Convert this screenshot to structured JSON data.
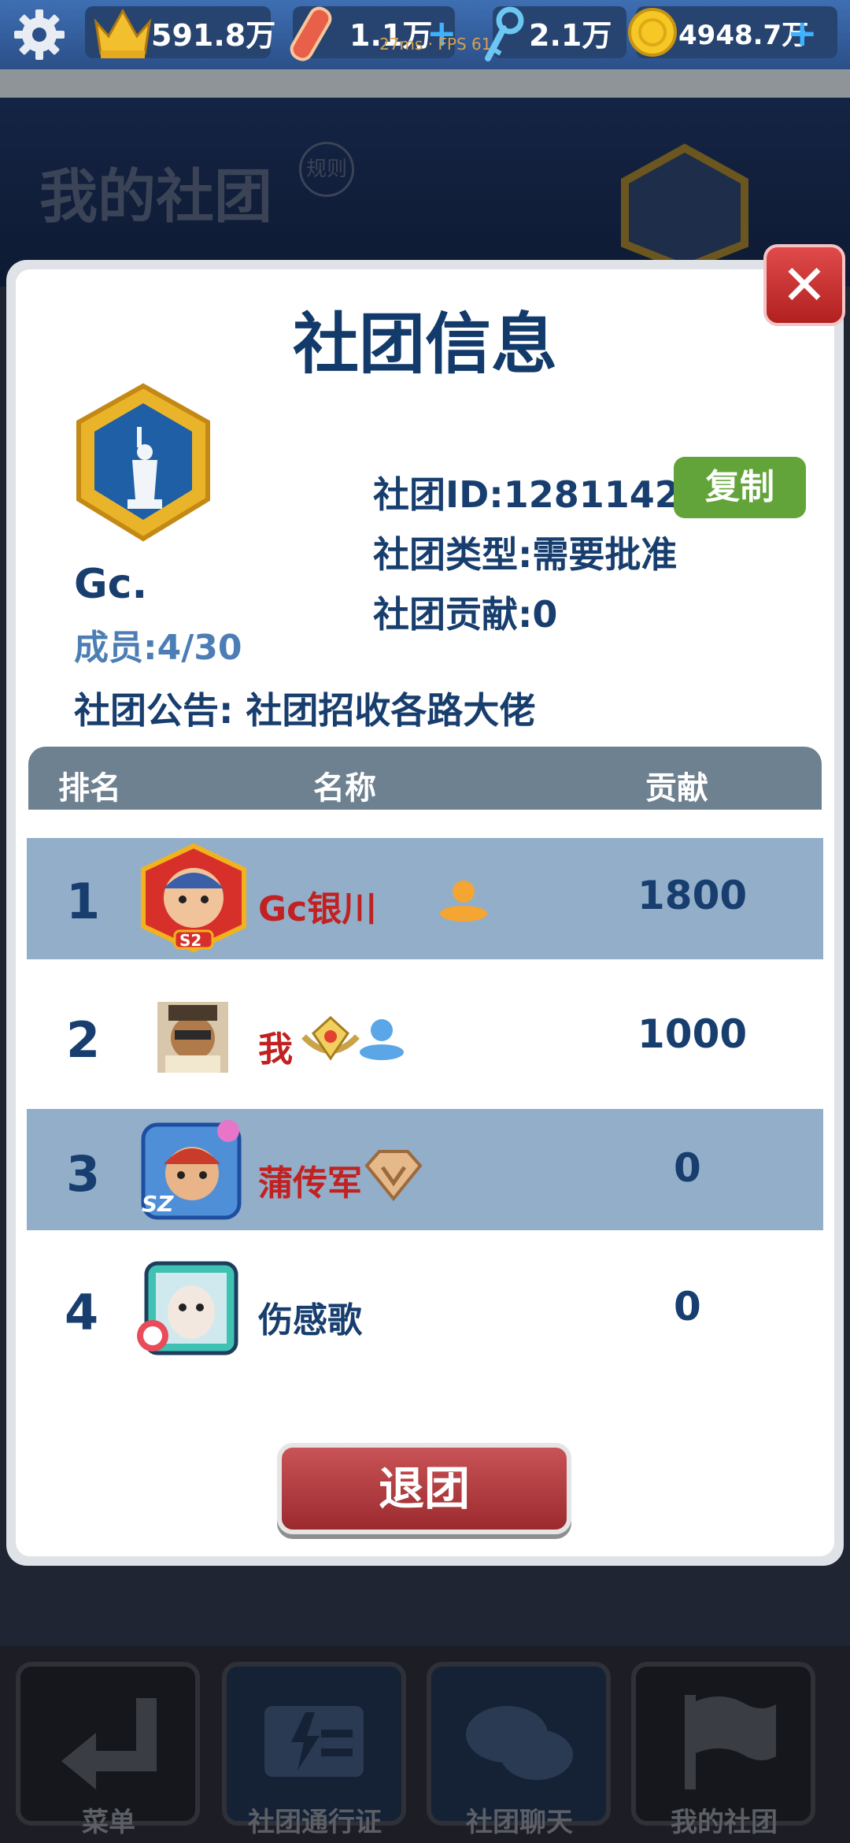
{
  "topbar": {
    "crowns": "591.8万",
    "boards": "1.1万",
    "keys": "2.1万",
    "coins": "4948.7万",
    "debug_overlay": "27ms · FPS 61"
  },
  "background": {
    "title": "我的社团",
    "rule_label": "规则"
  },
  "modal": {
    "title": "社团信息",
    "club_name": "Gc.",
    "members": "成员:4/30",
    "club_id": "社团ID:1281142",
    "copy_button": "复制",
    "club_type": "社团类型:需要批准",
    "club_contribution": "社团贡献:0",
    "notice": "社团公告:  社团招收各路大佬",
    "table": {
      "headers": [
        "排名",
        "名称",
        "贡献"
      ],
      "rows": [
        {
          "rank": "1",
          "name": "Gc银川",
          "contribution": "1800",
          "avatar_badge": "S2"
        },
        {
          "rank": "2",
          "name": "我",
          "contribution": "1000"
        },
        {
          "rank": "3",
          "name": "蒲传军",
          "contribution": "0",
          "avatar_badge": "SZ"
        },
        {
          "rank": "4",
          "name": "伤感歌",
          "contribution": "0"
        }
      ]
    },
    "quit_button": "退团"
  },
  "bottom_nav": {
    "items": [
      "菜单",
      "社团通行证",
      "社团聊天",
      "我的社团"
    ]
  },
  "colors": {
    "accent_blue": "#173e6e",
    "shaded_row": "#93aec9",
    "copy_green": "#62a43a",
    "quit_red": "#b3373c",
    "name_red": "#c12121"
  }
}
